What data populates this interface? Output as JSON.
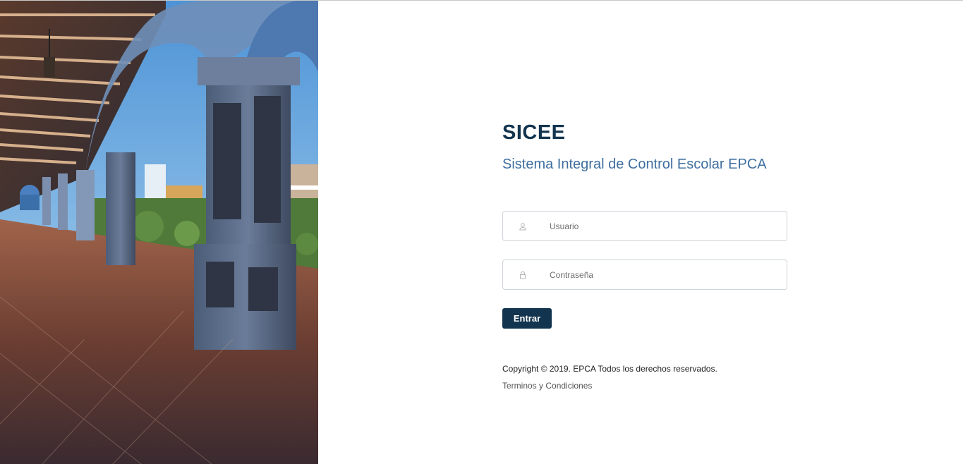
{
  "header": {
    "title": "SICEE",
    "subtitle": "Sistema Integral de Control Escolar EPCA"
  },
  "form": {
    "username": {
      "placeholder": "Usuario",
      "value": "",
      "icon": "user-icon"
    },
    "password": {
      "placeholder": "Contraseña",
      "value": "",
      "icon": "lock-icon"
    },
    "submit_label": "Entrar"
  },
  "footer": {
    "copyright": "Copyright © 2019. EPCA Todos los derechos reservados.",
    "terms_link": "Terminos y Condiciones"
  },
  "colors": {
    "primary": "#12344f",
    "subtitle": "#3f6f9f",
    "border": "#cfd4da"
  }
}
